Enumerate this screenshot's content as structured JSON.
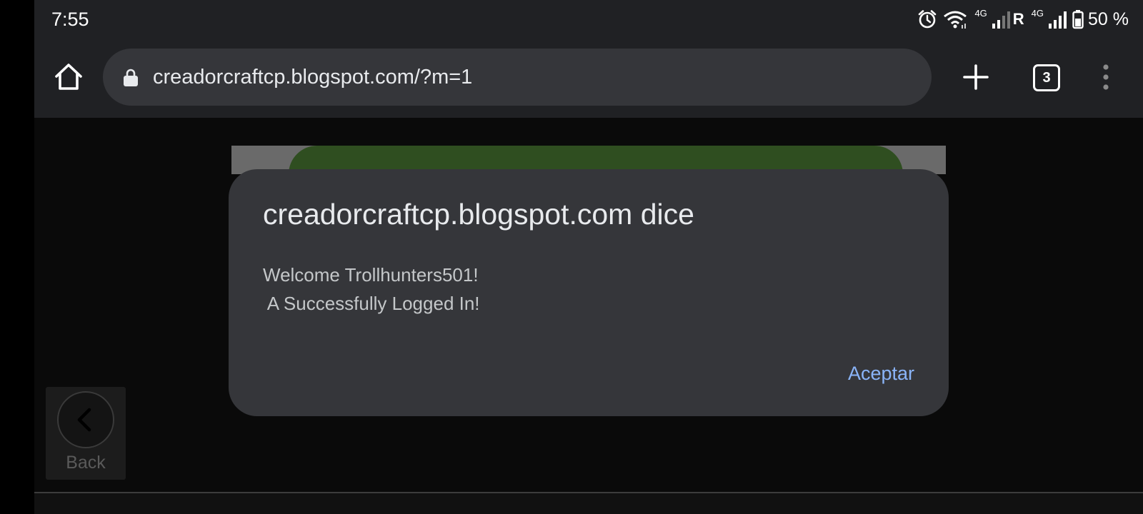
{
  "status_bar": {
    "time": "7:55",
    "icons": [
      "alarm-icon",
      "wifi-icon",
      "signal-4g-icon",
      "roaming-icon",
      "signal-4g-icon",
      "battery-icon"
    ],
    "network_tag_1": "4G",
    "roaming_label": "R",
    "network_tag_2": "4G",
    "battery_text": "50 %"
  },
  "toolbar": {
    "url": "creadorcraftcp.blogspot.com/?m=1",
    "tab_count": "3",
    "icons": [
      "home-icon",
      "lock-icon",
      "plus-icon",
      "tab-switcher-icon",
      "more-vert-icon"
    ]
  },
  "dialog": {
    "title": "creadorcraftcp.blogspot.com dice",
    "message_line_1": "Welcome Trollhunters501!",
    "message_line_2": " A Successfully Logged In!",
    "accept_label": "Aceptar",
    "accent_color": "#8ab4f8"
  },
  "page": {
    "back_label": "Back",
    "icons": [
      "chevron-left-icon"
    ],
    "banner_color": "#2f4e20"
  }
}
